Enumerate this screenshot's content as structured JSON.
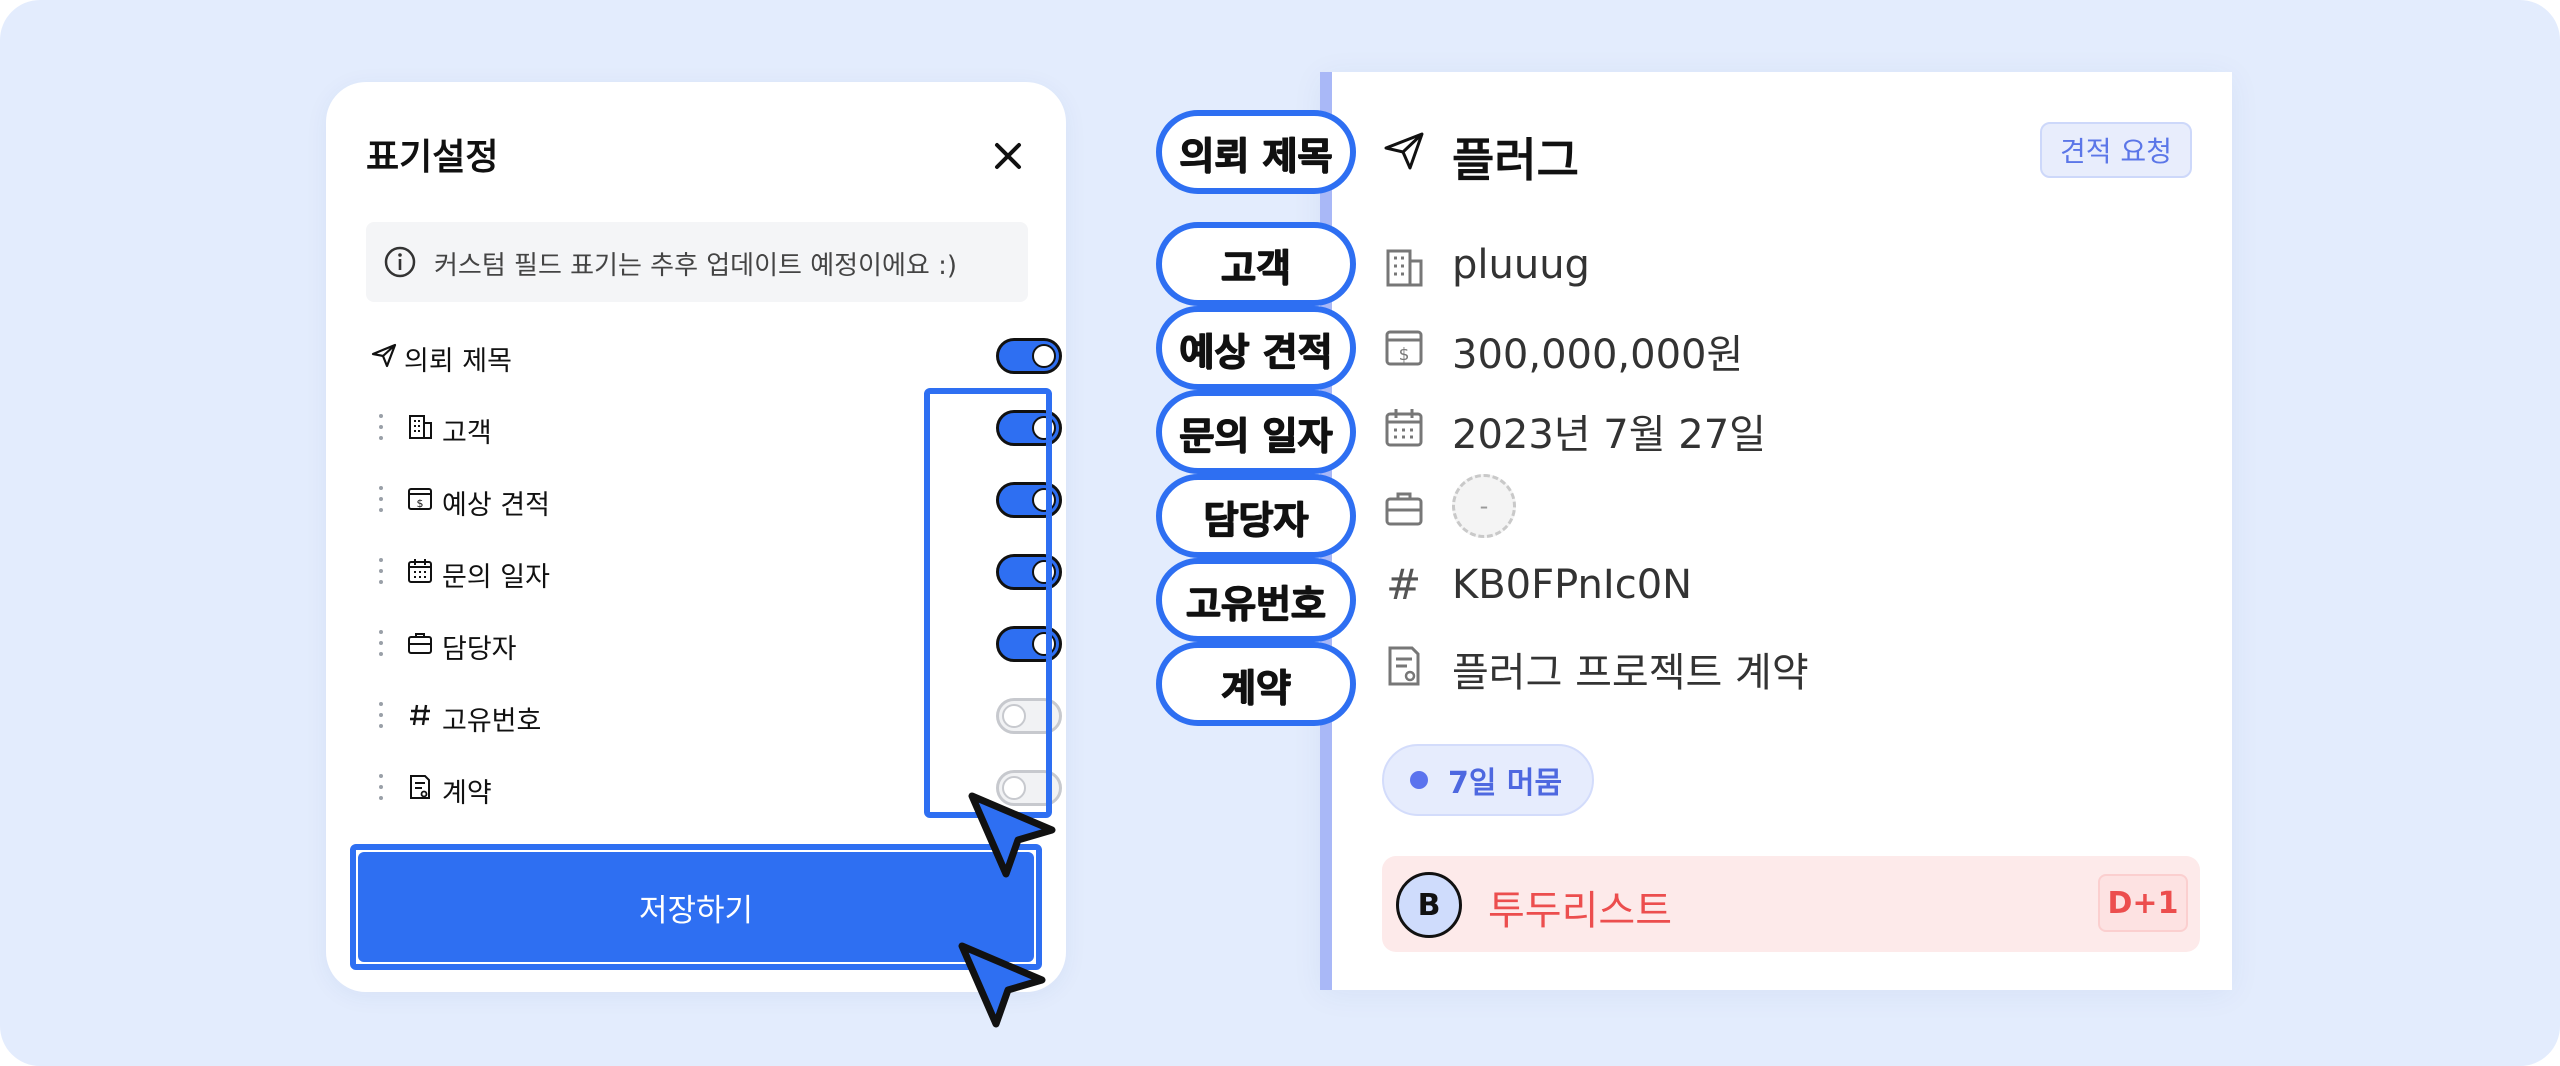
{
  "modal": {
    "title": "표기설정",
    "notice": "커스텀 필드 표기는 추후 업데이트 예정이에요 :)",
    "fields": [
      {
        "label": "의뢰 제목",
        "icon": "send-icon",
        "enabled": true,
        "draggable": false
      },
      {
        "label": "고객",
        "icon": "building-icon",
        "enabled": true,
        "draggable": true
      },
      {
        "label": "예상 견적",
        "icon": "estimate-icon",
        "enabled": true,
        "draggable": true
      },
      {
        "label": "문의 일자",
        "icon": "calendar-icon",
        "enabled": true,
        "draggable": true
      },
      {
        "label": "담당자",
        "icon": "briefcase-icon",
        "enabled": true,
        "draggable": true
      },
      {
        "label": "고유번호",
        "icon": "hash-icon",
        "enabled": false,
        "draggable": true
      },
      {
        "label": "계약",
        "icon": "contract-icon",
        "enabled": false,
        "draggable": true
      }
    ],
    "save_label": "저장하기"
  },
  "card": {
    "title": "플러그",
    "request_badge": "견적 요청",
    "customer": "pluuug",
    "estimate": "300,000,000원",
    "inquiry_date": "2023년 7월 27일",
    "manager_placeholder": "-",
    "hash_symbol": "#",
    "unique_id": "KB0FPnIc0N",
    "contract": "플러그 프로젝트 계약",
    "stay_label": "7일 머뭄",
    "todo": {
      "avatar": "B",
      "label": "투두리스트",
      "due": "D+1"
    }
  },
  "callouts": [
    "의뢰 제목",
    "고객",
    "예상 견적",
    "문의 일자",
    "담당자",
    "고유번호",
    "계약"
  ],
  "colors": {
    "accent": "#2e6ff2",
    "background": "#e3ecfd",
    "card_bar": "#a9b8f7",
    "todo_red": "#ec4e4e",
    "stay_blue": "#4e68e0"
  }
}
